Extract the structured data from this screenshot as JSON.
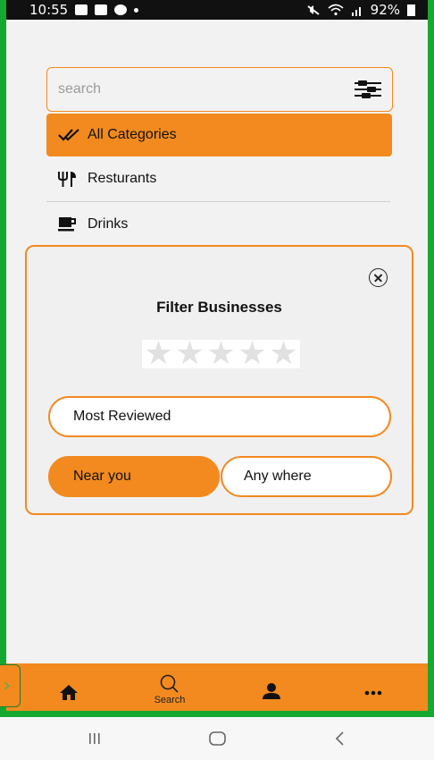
{
  "statusbar": {
    "time": "10:55",
    "battery": "92%"
  },
  "search": {
    "placeholder": "search"
  },
  "categories": [
    {
      "label": "All Categories",
      "icon": "double-check-icon",
      "active": true
    },
    {
      "label": "Resturants",
      "icon": "fork-knife-icon"
    },
    {
      "label": "Drinks",
      "icon": "coffee-cup-icon"
    }
  ],
  "filter_modal": {
    "title": "Filter Businesses",
    "rating_stars": 5,
    "rating_selected": 0,
    "sort_option": "Most Reviewed",
    "location_options": [
      {
        "label": "Near you",
        "selected": true
      },
      {
        "label": "Any where",
        "selected": false
      }
    ]
  },
  "bottom_nav": [
    {
      "icon": "home-icon",
      "label": ""
    },
    {
      "icon": "search-icon",
      "label": "Search"
    },
    {
      "icon": "profile-icon",
      "label": ""
    },
    {
      "icon": "more-icon",
      "label": ""
    }
  ],
  "colors": {
    "accent": "#f28a1f",
    "frame": "#16a832",
    "background": "#f2f2f2"
  }
}
